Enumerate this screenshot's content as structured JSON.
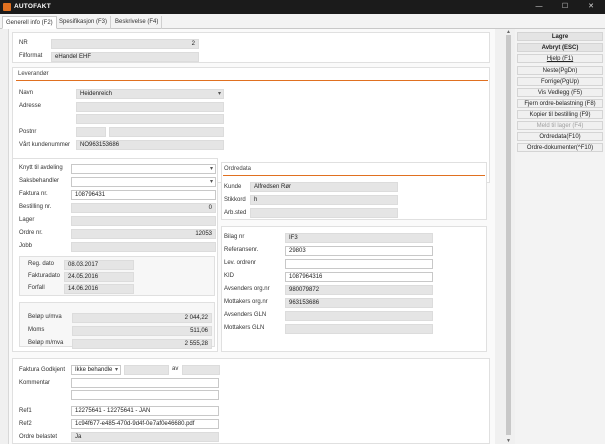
{
  "app": {
    "title": "AUTOFAKT"
  },
  "window": {
    "minimize": "—",
    "maximize": "☐",
    "close": "✕"
  },
  "tabs": [
    "Generell info (F2)",
    "Spesifikasjon (F3)",
    "Beskrivelse (F4)"
  ],
  "header": {
    "nr_label": "NR",
    "nr_value": "2",
    "format_label": "Filformat",
    "format_value": "eHandel EHF"
  },
  "leverandor": {
    "section": "Leverandør",
    "navn_label": "Navn",
    "navn_value": "Heidenreich",
    "adresse_label": "Adresse",
    "postnr_label": "Postnr",
    "kundenr_label": "Vårt kundenummer",
    "kundenr_value": "NO963153686"
  },
  "left_form": {
    "avdeling_label": "Knytt til avdeling",
    "saksbehandler_label": "Saksbehandler",
    "faktura_label": "Faktura nr.",
    "faktura_value": "108796431",
    "bestilling_label": "Bestilling nr.",
    "bestilling_value": "0",
    "lager_label": "Lager",
    "ordre_label": "Ordre nr.",
    "ordre_value": "12053",
    "jobb_label": "Jobb"
  },
  "dates": {
    "reg_label": "Reg. dato",
    "reg_value": "08.03.2017",
    "fakt_label": "Fakturadato",
    "fakt_value": "24.05.2016",
    "forfall_label": "Forfall",
    "forfall_value": "14.06.2016"
  },
  "totals": {
    "belop_u_label": "Beløp u/mva",
    "belop_u_value": "2 044,22",
    "moms_label": "Moms",
    "moms_value": "511,06",
    "belop_m_label": "Beløp m/mva",
    "belop_m_value": "2 555,28"
  },
  "ordredata": {
    "section": "Ordredata",
    "kunde_label": "Kunde",
    "kunde_value": "Alfredsen Rør",
    "stikkord_label": "Stikkord",
    "stikkord_value": "h",
    "arbsted_label": "Arb.sted"
  },
  "bilag": {
    "bilag_label": "Bilag nr",
    "bilag_value": "IF3",
    "ref_label": "Referansenr.",
    "ref_value": "29803",
    "lev_label": "Lev. ordrenr",
    "kid_label": "KID",
    "kid_value": "1087964316",
    "avs_org_label": "Avsenders org.nr",
    "avs_org_value": "980079872",
    "mot_org_label": "Mottakers org.nr",
    "mot_org_value": "963153686",
    "avs_gln_label": "Avsenders GLN",
    "mot_gln_label": "Mottakers GLN"
  },
  "bottom": {
    "godkjent_label": "Faktura Godkjent",
    "godkjent_value": "Ikke behandle",
    "av_label": "av",
    "kommentar_label": "Kommentar",
    "ref1_label": "Ref1",
    "ref1_value": "12275641 - 12275641 - JAN",
    "ref2_label": "Ref2",
    "ref2_value": "1c94f677-e485-470d-9d4f-0e7af0e46680.pdf",
    "belastet_label": "Ordre belastet",
    "belastet_value": "Ja"
  },
  "actions": {
    "lagre": "Lagre",
    "avbryt": "Avbryt (ESC)",
    "hjelp": "Hjelp (F1)",
    "neste": "Neste(PgDn)",
    "forrige": "Forrige(PgUp)",
    "vedlegg": "Vis Vedlegg (F5)",
    "fjern": "Fjern ordre-belastning (F8)",
    "kopier": "Kopier til bestilling (F9)",
    "meld": "Meld til lager (F4)",
    "ordredata": "Ordredata(F10)",
    "ordre_dok": "Ordre-dokumenter(^F10)"
  }
}
